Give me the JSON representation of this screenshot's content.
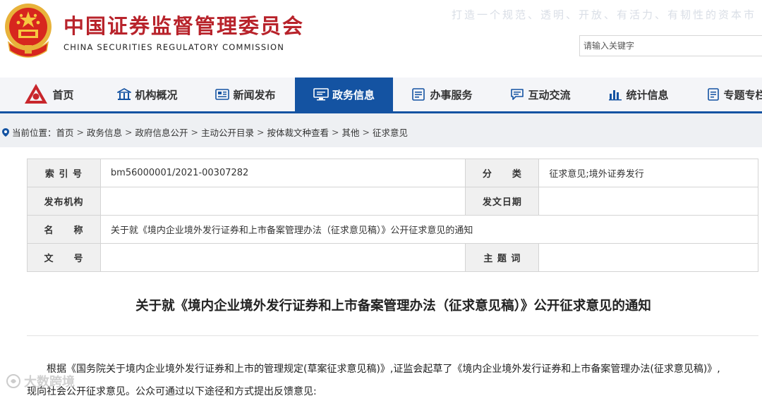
{
  "header": {
    "org_name_cn": "中国证券监督管理委员会",
    "org_name_en": "CHINA SECURITIES REGULATORY COMMISSION",
    "slogan": "打造一个规范、透明、开放、有活力、有韧性的资本市",
    "search_placeholder": "请输入关键字"
  },
  "nav": {
    "items": [
      {
        "label": "首页",
        "icon": "csrc-logo-icon"
      },
      {
        "label": "机构概况",
        "icon": "building-icon"
      },
      {
        "label": "新闻发布",
        "icon": "news-icon"
      },
      {
        "label": "政务信息",
        "icon": "monitor-icon",
        "active": true
      },
      {
        "label": "办事服务",
        "icon": "list-icon"
      },
      {
        "label": "互动交流",
        "icon": "chat-icon"
      },
      {
        "label": "统计信息",
        "icon": "bar-chart-icon"
      },
      {
        "label": "专题专栏",
        "icon": "book-icon"
      }
    ],
    "active_color": "#1453a2"
  },
  "breadcrumb": {
    "prefix": "当前位置：",
    "items": [
      "首页",
      "政务信息",
      "政府信息公开",
      "主动公开目录",
      "按体裁文种查看",
      "其他",
      "征求意见"
    ],
    "separator": ">"
  },
  "meta": {
    "index_label": "索 引 号",
    "index_value": "bm56000001/2021-00307282",
    "category_label": "分　　类",
    "category_value": "征求意见;境外证券发行",
    "publisher_label": "发布机构",
    "publisher_value": "",
    "date_label": "发文日期",
    "date_value": "",
    "name_label": "名　　称",
    "name_value": "关于就《境内企业境外发行证券和上市备案管理办法（征求意见稿）》公开征求意见的通知",
    "docno_label": "文　　号",
    "docno_value": "",
    "subject_label": "主 题 词",
    "subject_value": ""
  },
  "document": {
    "title": "关于就《境内企业境外发行证券和上市备案管理办法（征求意见稿）》公开征求意见的通知",
    "para_line1": "根据《国务院关于境内企业境外发行证券和上市的管理规定(草案征求意见稿)》,证监会起草了《境内企业境外发行证券和上市备案管理办法(征求意见稿)》,",
    "para_line2": "现向社会公开征求意见。公众可通过以下途径和方式提出反馈意见:"
  },
  "watermark": "大数跨境",
  "colors": {
    "brand_red": "#b8232b",
    "nav_blue": "#1453a2"
  }
}
